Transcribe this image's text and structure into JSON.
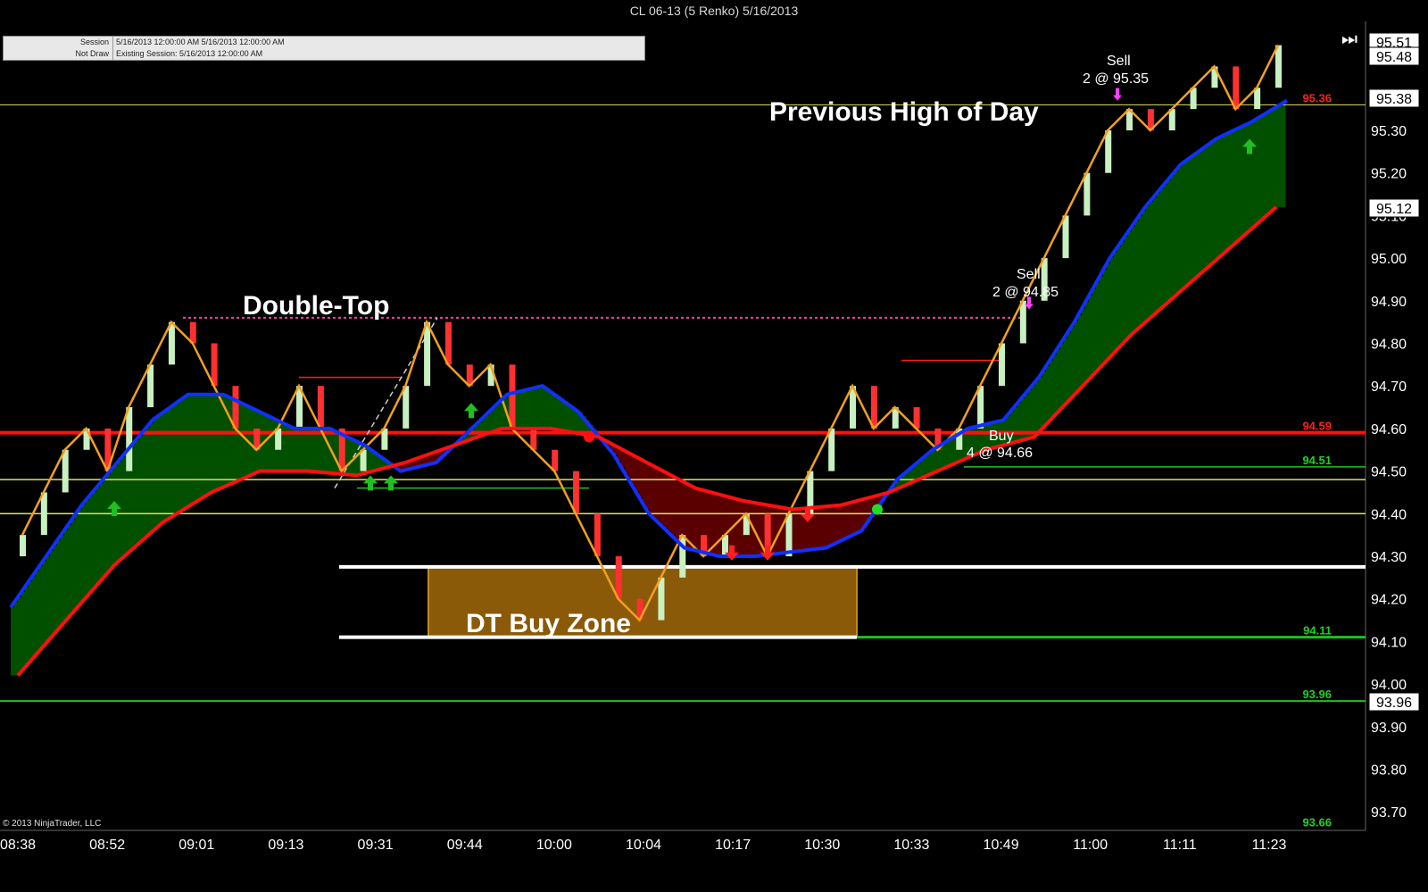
{
  "window_title": "CL 06-13 (5 Renko)  5/16/2013",
  "session_info": [
    {
      "key": "Session",
      "value": "5/16/2013 12:00:00 AM 5/16/2013 12:00:00 AM"
    },
    {
      "key": "Not Draw",
      "value": "Existing Session: 5/16/2013 12:00:00 AM"
    }
  ],
  "copyright": "© 2013 NinjaTrader, LLC",
  "annotations": {
    "double_top": "Double-Top",
    "previous_high": "Previous High of Day",
    "buy_zone": "DT Buy Zone",
    "sell1_a": "Sell",
    "sell1_b": "2 @ 94.85",
    "sell2_a": "Sell",
    "sell2_b": "2 @ 95.35",
    "buy_a": "Buy",
    "buy_b": "4 @ 94.66"
  },
  "price_tags": {
    "last": "95.51",
    "above": "95.48",
    "high": "95.38",
    "mid": "95.12",
    "low": "93.96"
  },
  "level_labels": [
    {
      "price": 95.36,
      "text": "95.36",
      "color": "#ff2020"
    },
    {
      "price": 94.59,
      "text": "94.59",
      "color": "#ff2020"
    },
    {
      "price": 94.51,
      "text": "94.51",
      "color": "#20d020"
    },
    {
      "price": 94.11,
      "text": "94.11",
      "color": "#20d020"
    },
    {
      "price": 93.96,
      "text": "93.96",
      "color": "#20d020"
    },
    {
      "price": 93.66,
      "text": "93.66",
      "color": "#20d020"
    }
  ],
  "chart_data": {
    "type": "line",
    "title": "CL 06-13 (5 Renko)  5/16/2013",
    "y_ticks": [
      "95.30",
      "95.20",
      "95.10",
      "95.00",
      "94.90",
      "94.80",
      "94.70",
      "94.60",
      "94.50",
      "94.40",
      "94.30",
      "94.20",
      "94.10",
      "94.00",
      "93.90",
      "93.80",
      "93.70"
    ],
    "x_ticks": [
      "08:38",
      "08:52",
      "09:01",
      "09:13",
      "09:31",
      "09:44",
      "10:00",
      "10:04",
      "10:17",
      "10:30",
      "10:33",
      "10:49",
      "11:00",
      "11:11",
      "11:23"
    ],
    "ylim": [
      93.66,
      95.56
    ],
    "horizontal_levels": [
      95.36,
      94.59,
      94.51,
      94.48,
      94.4,
      94.275,
      94.11,
      93.96
    ],
    "double_top_level": 94.86,
    "buy_zone": {
      "low": 94.11,
      "high": 94.275
    },
    "colors": {
      "up_bar": "#c8f0c0",
      "down_bar": "#ff3030",
      "blue_ma": "#1030ff",
      "red_ma": "#ff1010",
      "orange_ma": "#f0a020",
      "cloud_bull": "#005000",
      "cloud_bear": "#5a0000"
    },
    "series": [
      {
        "name": "Renko close",
        "values": [
          94.35,
          94.45,
          94.55,
          94.6,
          94.5,
          94.65,
          94.75,
          94.85,
          94.8,
          94.7,
          94.6,
          94.55,
          94.6,
          94.7,
          94.6,
          94.5,
          94.55,
          94.6,
          94.7,
          94.85,
          94.75,
          94.7,
          94.75,
          94.6,
          94.55,
          94.5,
          94.4,
          94.3,
          94.2,
          94.15,
          94.25,
          94.35,
          94.3,
          94.35,
          94.4,
          94.3,
          94.4,
          94.5,
          94.6,
          94.7,
          94.6,
          94.65,
          94.6,
          94.55,
          94.6,
          94.7,
          94.8,
          94.9,
          95.0,
          95.1,
          95.2,
          95.3,
          95.35,
          95.3,
          95.35,
          95.4,
          95.45,
          95.35,
          95.4,
          95.5
        ]
      },
      {
        "name": "Blue MA",
        "values": [
          94.18,
          94.3,
          94.42,
          94.52,
          94.62,
          94.68,
          94.68,
          94.64,
          94.6,
          94.6,
          94.56,
          94.5,
          94.52,
          94.6,
          94.68,
          94.7,
          94.64,
          94.54,
          94.4,
          94.32,
          94.3,
          94.3,
          94.31,
          94.32,
          94.36,
          94.48,
          94.55,
          94.6,
          94.62,
          94.72,
          94.85,
          95.0,
          95.12,
          95.22,
          95.28,
          95.32,
          95.37
        ]
      },
      {
        "name": "Red MA",
        "values": [
          94.02,
          94.15,
          94.28,
          94.38,
          94.45,
          94.5,
          94.5,
          94.49,
          94.52,
          94.56,
          94.6,
          94.6,
          94.58,
          94.52,
          94.46,
          94.43,
          94.41,
          94.42,
          94.45,
          94.5,
          94.55,
          94.58,
          94.7,
          94.82,
          94.92,
          95.02,
          95.12
        ]
      }
    ]
  }
}
